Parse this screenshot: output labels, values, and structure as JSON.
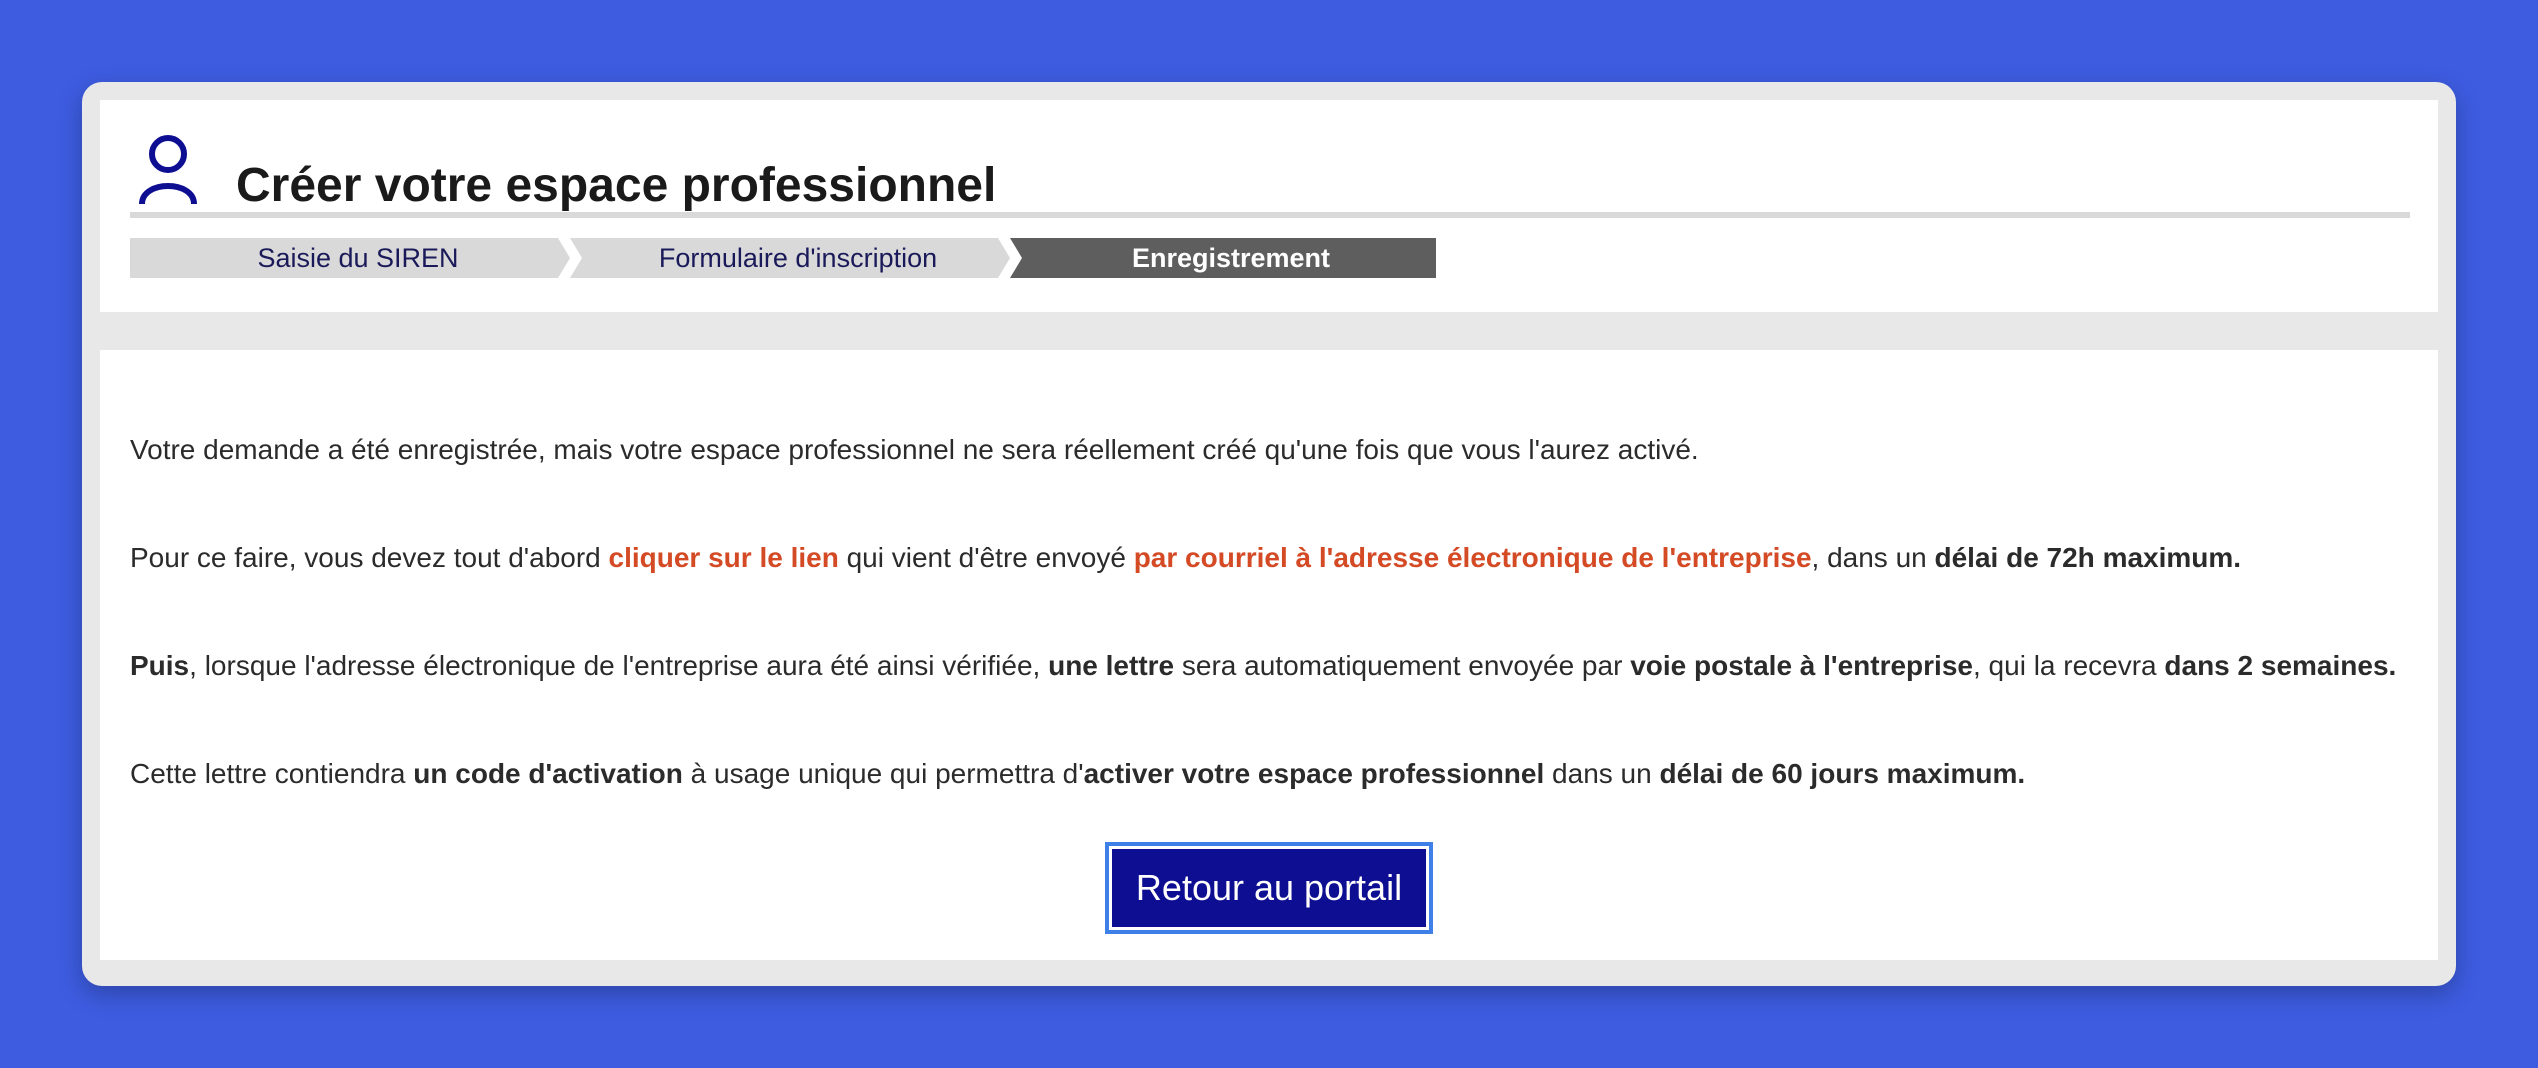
{
  "header": {
    "title": "Créer votre espace professionnel",
    "icon": "user-icon",
    "accent_color": "#0e0e92"
  },
  "steps": [
    {
      "label": "Saisie du SIREN",
      "active": false
    },
    {
      "label": "Formulaire d'inscription",
      "active": false
    },
    {
      "label": "Enregistrement",
      "active": true
    }
  ],
  "content": {
    "p1": {
      "text": "Votre demande a été enregistrée, mais votre espace professionnel ne sera réellement créé qu'une fois que vous l'aurez activé."
    },
    "p2": {
      "a": "Pour ce faire, vous devez tout d'abord ",
      "b": "cliquer sur le lien",
      "c": " qui vient d'être envoyé ",
      "d": "par courriel à l'adresse électronique de l'entreprise",
      "e": ", dans un ",
      "f": "délai de 72h maximum."
    },
    "p3": {
      "a": "Puis",
      "b": ", lorsque l'adresse électronique de l'entreprise aura été ainsi vérifiée, ",
      "c": "une lettre",
      "d": " sera automatiquement envoyée par ",
      "e": "voie postale à l'entreprise",
      "f": ", qui la recevra ",
      "g": "dans 2 semaines."
    },
    "p4": {
      "a": "Cette lettre contiendra ",
      "b": "un code d'activation",
      "c": " à usage unique qui permettra d'",
      "d": "activer votre espace professionnel",
      "e": " dans un ",
      "f": "délai de 60 jours maximum."
    },
    "highlight_color": "#d44a25"
  },
  "button": {
    "label": "Retour au portail"
  }
}
